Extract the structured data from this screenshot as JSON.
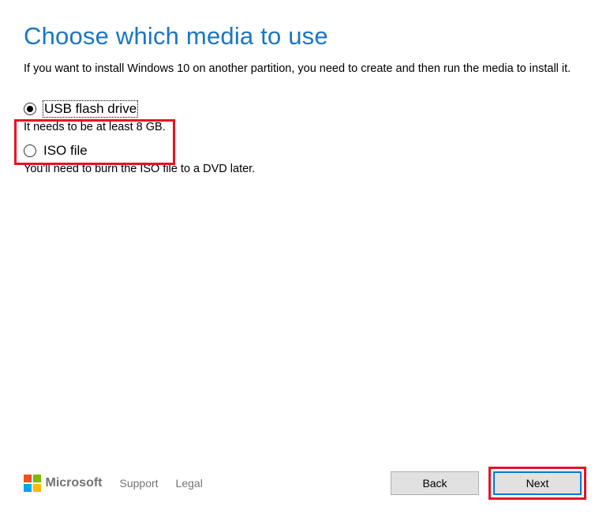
{
  "title": "Choose which media to use",
  "description": "If you want to install Windows 10 on another partition, you need to create and then run the media to install it.",
  "options": [
    {
      "label": "USB flash drive",
      "sub": "It needs to be at least 8 GB.",
      "selected": true,
      "focused": true
    },
    {
      "label": "ISO file",
      "sub": "You'll need to burn the ISO file to a DVD later.",
      "selected": false,
      "focused": false
    }
  ],
  "footer": {
    "brand": "Microsoft",
    "support": "Support",
    "legal": "Legal",
    "back": "Back",
    "next": "Next"
  },
  "highlight_color": "#e81123"
}
